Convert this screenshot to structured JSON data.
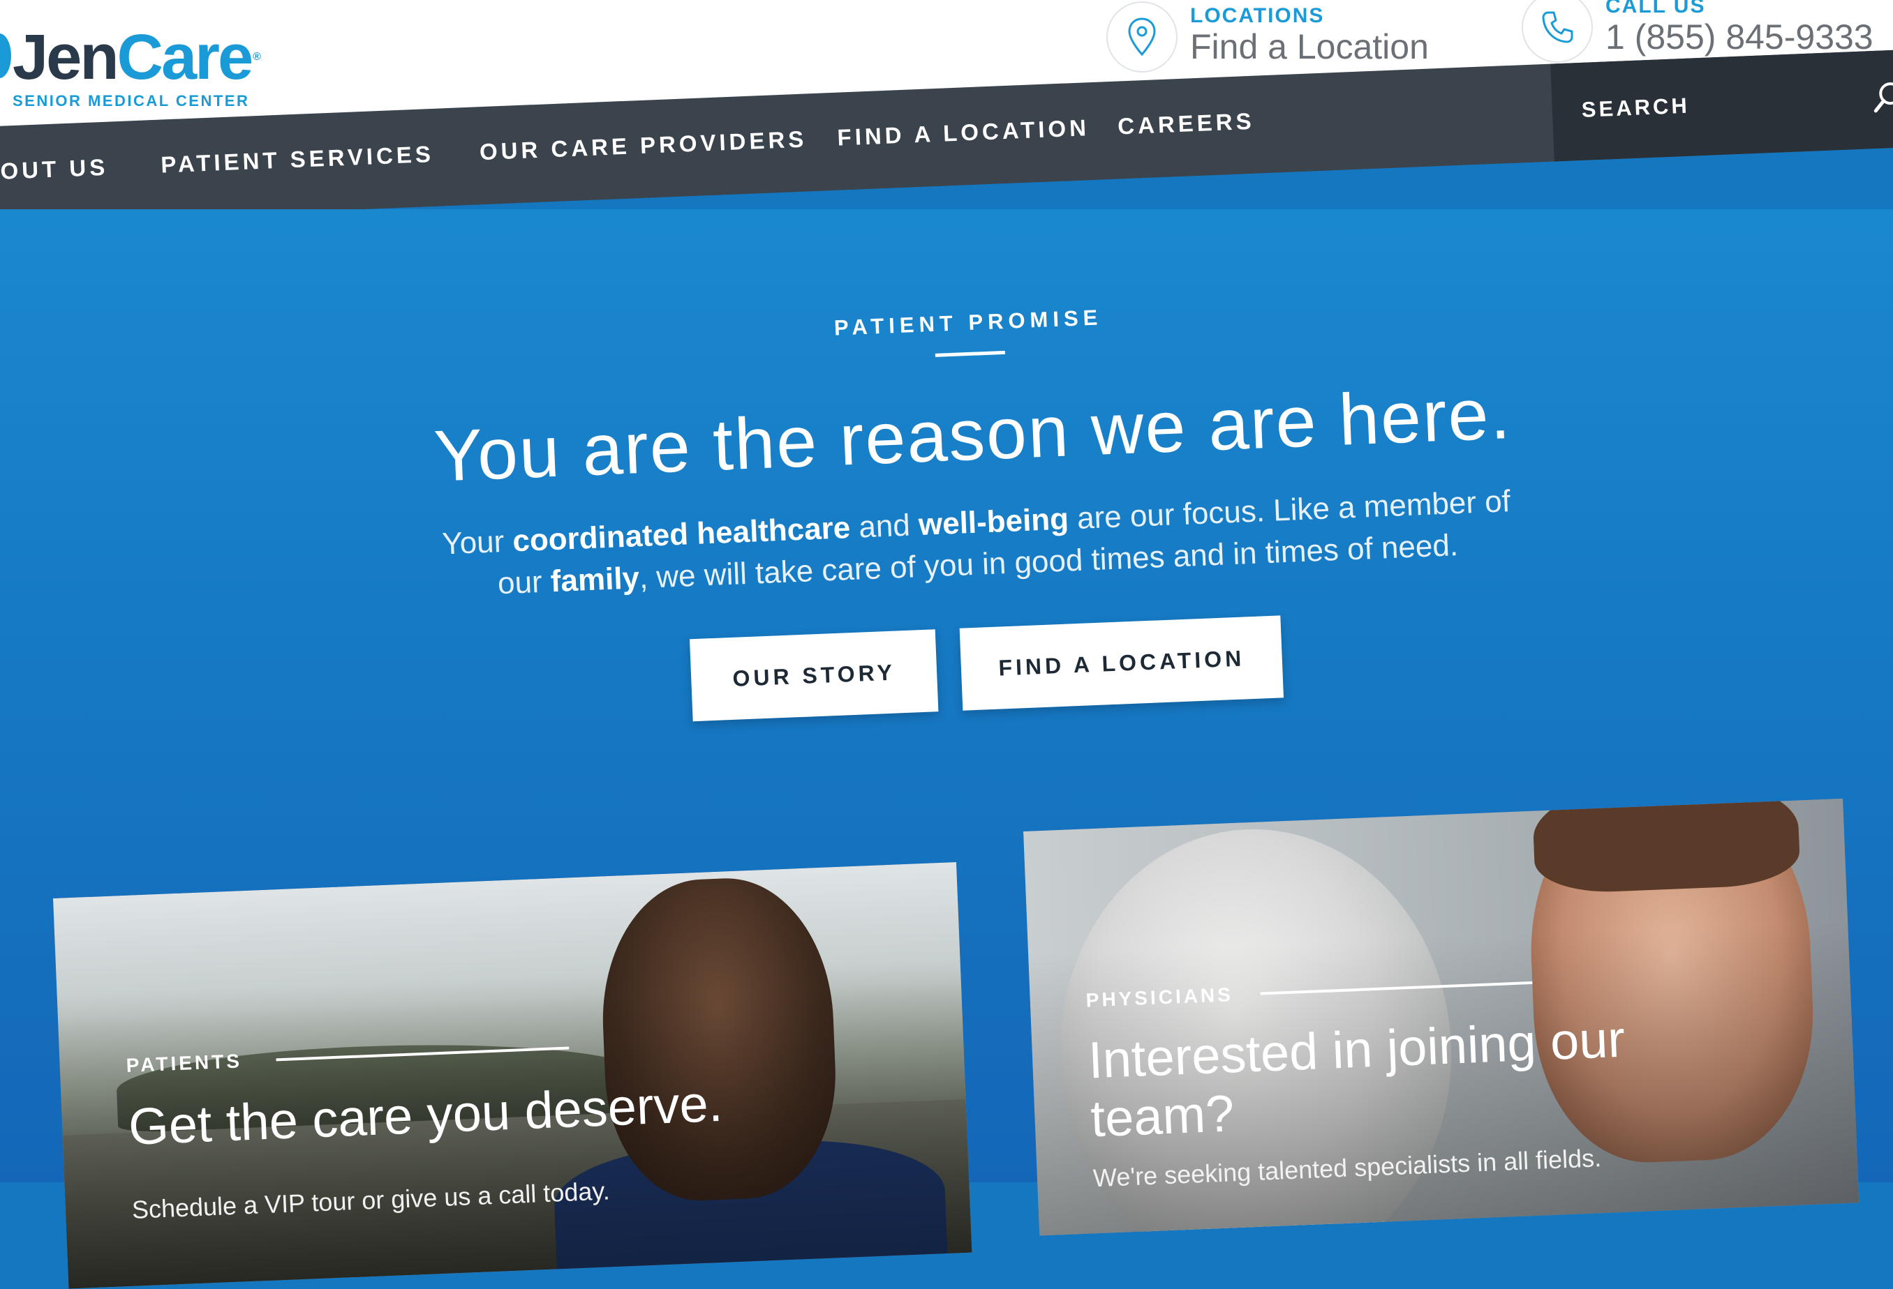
{
  "brand": {
    "name_jen": "Jen",
    "name_care": "Care",
    "registered": "®",
    "tagline": "SENIOR MEDICAL CENTER"
  },
  "header": {
    "locations": {
      "label": "LOCATIONS",
      "value": "Find a Location"
    },
    "call": {
      "label": "CALL US",
      "value": "1 (855) 845-9333"
    }
  },
  "nav": {
    "items": [
      {
        "label": "OUT US"
      },
      {
        "label": "PATIENT SERVICES"
      },
      {
        "label": "OUR CARE PROVIDERS"
      },
      {
        "label": "FIND A LOCATION"
      },
      {
        "label": "CAREERS"
      }
    ],
    "search_placeholder": "SEARCH"
  },
  "hero": {
    "eyebrow": "PATIENT PROMISE",
    "headline": "You are the reason we are here.",
    "subcopy": {
      "t1": "Your ",
      "b1": "coordinated healthcare",
      "t2": " and ",
      "b2": "well-being",
      "t3": " are our focus. Like a member of",
      "t4": "our ",
      "b3": "family",
      "t5": ", we will take care of you in good times and in times of need."
    },
    "buttons": {
      "story": "OUR STORY",
      "find": "FIND A LOCATION"
    }
  },
  "cards": {
    "patients": {
      "eyebrow": "PATIENTS",
      "title": "Get the care you deserve.",
      "text": "Schedule a VIP tour or give us a call today."
    },
    "physicians": {
      "eyebrow": "PHYSICIANS",
      "title_line1": "Interested in joining our",
      "title_line2": "team?",
      "text": "We're seeking talented specialists in all fields."
    }
  },
  "colors": {
    "brand_blue": "#1a9bd7",
    "nav_dark": "#3b434c",
    "hero_blue": "#1679c3"
  }
}
